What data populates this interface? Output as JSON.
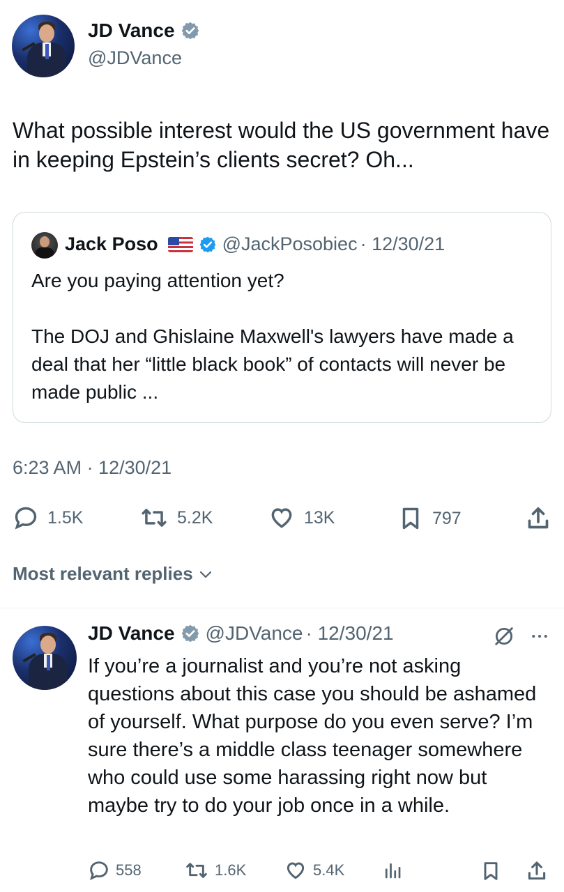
{
  "main_tweet": {
    "author_name": "JD Vance",
    "author_handle": "@JDVance",
    "text": "What possible interest would the US government have in keeping Epstein’s clients secret? Oh...",
    "timestamp": "6:23 AM · 12/30/21",
    "stats": {
      "replies": "1.5K",
      "reposts": "5.2K",
      "likes": "13K",
      "bookmarks": "797"
    }
  },
  "quoted_tweet": {
    "author_name": "Jack Poso",
    "author_handle": "@JackPosobiec",
    "date": "· 12/30/21",
    "text_line1": "Are you paying attention yet?",
    "text_body": "The DOJ and Ghislaine Maxwell's lawyers have made a deal that her “little black book” of contacts will never be made public ..."
  },
  "replies_filter": {
    "label": "Most relevant replies"
  },
  "reply": {
    "author_name": "JD Vance",
    "author_handle": "@JDVance",
    "date": "· 12/30/21",
    "text": "If you’re a journalist and you’re not asking questions about this case you should be ashamed of yourself. What purpose do you even serve? I’m sure there’s a middle class teenager somewhere who could use some harassing right now but maybe try to do your job once in a while.",
    "stats": {
      "replies": "558",
      "reposts": "1.6K",
      "likes": "5.4K"
    }
  },
  "colors": {
    "verified_badge": "#829aab",
    "text_secondary": "#536471",
    "border": "#cfd9de"
  },
  "icons": [
    "verified-badge-icon",
    "us-flag-icon",
    "reply-icon",
    "repost-icon",
    "like-icon",
    "bookmark-icon",
    "share-icon",
    "chevron-down-icon",
    "grok-icon",
    "more-icon",
    "analytics-icon"
  ]
}
